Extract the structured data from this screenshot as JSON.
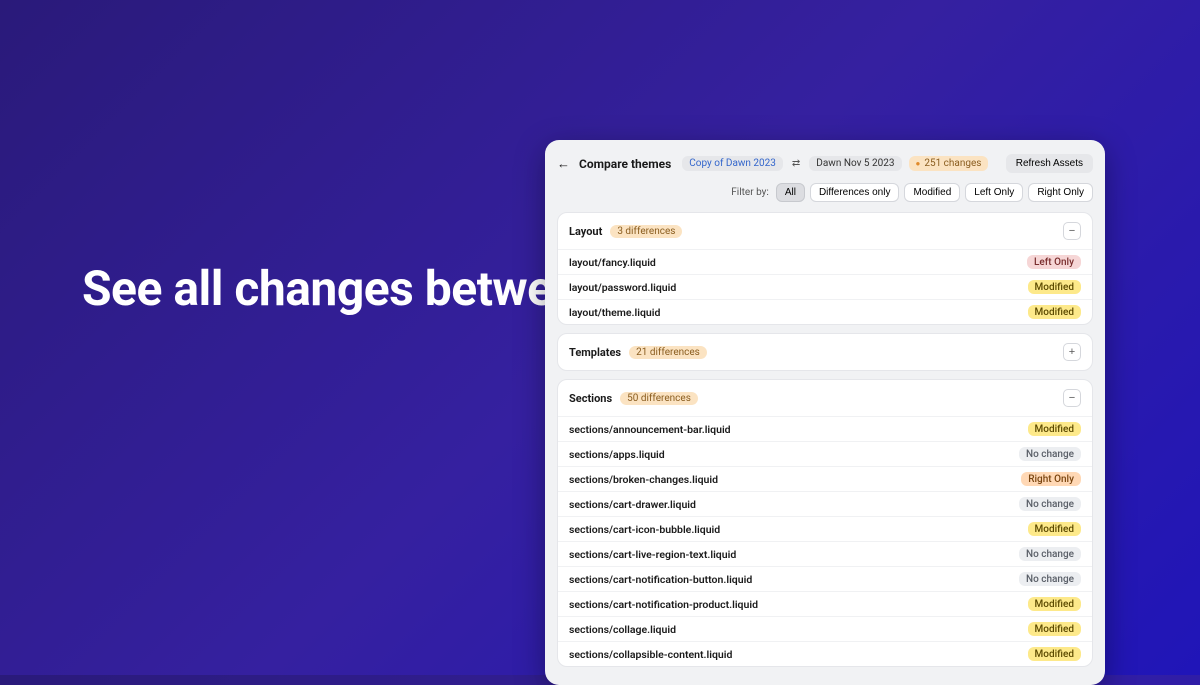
{
  "headline": "See  all changes between  your themes.",
  "header": {
    "title": "Compare themes",
    "theme_a": "Copy of Dawn 2023",
    "theme_b": "Dawn Nov 5 2023",
    "total_changes": "251 changes",
    "refresh_label": "Refresh Assets"
  },
  "filters": {
    "label": "Filter by:",
    "options": [
      "All",
      "Differences only",
      "Modified",
      "Left Only",
      "Right Only"
    ],
    "active": "All"
  },
  "groups": [
    {
      "name": "Layout",
      "diff_count": "3 differences",
      "expanded": true,
      "collapse_icon": "−",
      "rows": [
        {
          "file": "layout/fancy.liquid",
          "status": "Left Only",
          "status_class": "leftonly"
        },
        {
          "file": "layout/password.liquid",
          "status": "Modified",
          "status_class": "modified"
        },
        {
          "file": "layout/theme.liquid",
          "status": "Modified",
          "status_class": "modified"
        }
      ]
    },
    {
      "name": "Templates",
      "diff_count": "21 differences",
      "expanded": false,
      "collapse_icon": "+",
      "rows": []
    },
    {
      "name": "Sections",
      "diff_count": "50 differences",
      "expanded": true,
      "collapse_icon": "−",
      "rows": [
        {
          "file": "sections/announcement-bar.liquid",
          "status": "Modified",
          "status_class": "modified"
        },
        {
          "file": "sections/apps.liquid",
          "status": "No change",
          "status_class": "nochange"
        },
        {
          "file": "sections/broken-changes.liquid",
          "status": "Right Only",
          "status_class": "rightonly"
        },
        {
          "file": "sections/cart-drawer.liquid",
          "status": "No change",
          "status_class": "nochange"
        },
        {
          "file": "sections/cart-icon-bubble.liquid",
          "status": "Modified",
          "status_class": "modified"
        },
        {
          "file": "sections/cart-live-region-text.liquid",
          "status": "No change",
          "status_class": "nochange"
        },
        {
          "file": "sections/cart-notification-button.liquid",
          "status": "No change",
          "status_class": "nochange"
        },
        {
          "file": "sections/cart-notification-product.liquid",
          "status": "Modified",
          "status_class": "modified"
        },
        {
          "file": "sections/collage.liquid",
          "status": "Modified",
          "status_class": "modified"
        },
        {
          "file": "sections/collapsible-content.liquid",
          "status": "Modified",
          "status_class": "modified"
        }
      ]
    }
  ]
}
